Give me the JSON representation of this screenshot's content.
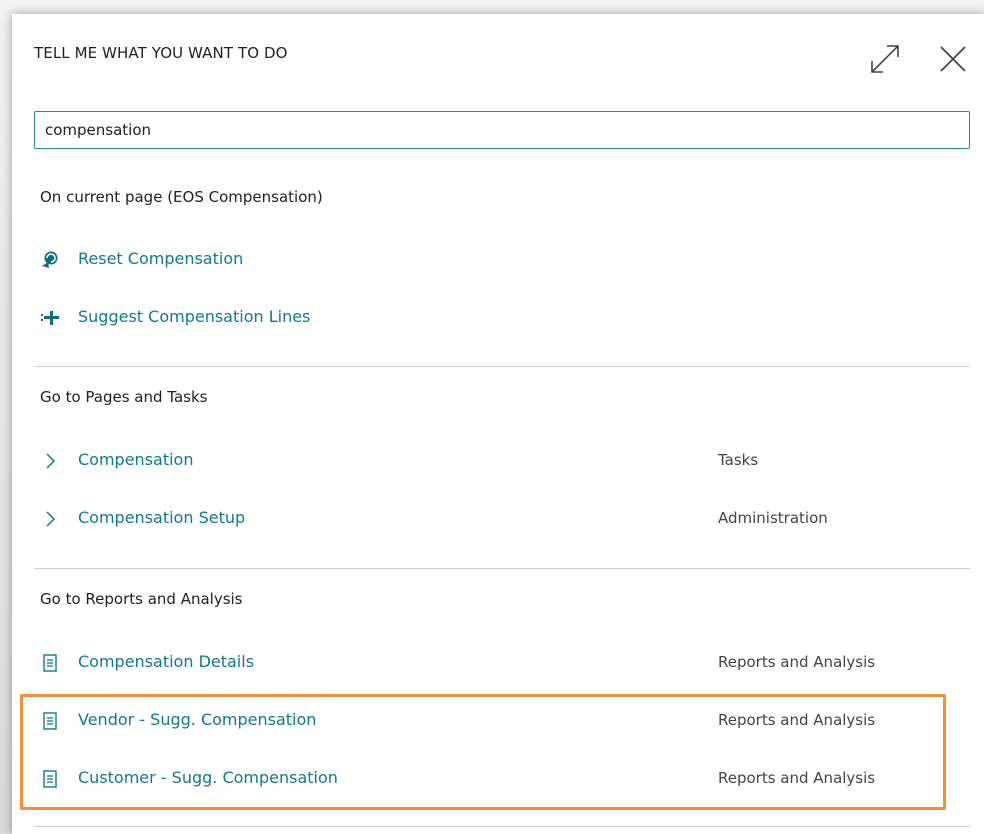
{
  "dialog": {
    "title": "TELL ME WHAT YOU WANT TO DO",
    "expand_icon": "expand-icon",
    "close_icon": "close-icon"
  },
  "search": {
    "value": "compensation",
    "placeholder": ""
  },
  "sections": {
    "current_page": {
      "header": "On current page (EOS Compensation)",
      "items": [
        {
          "label": "Reset Compensation",
          "icon": "reset-icon"
        },
        {
          "label": "Suggest Compensation Lines",
          "icon": "suggest-lines-icon"
        }
      ]
    },
    "pages_tasks": {
      "header": "Go to Pages and Tasks",
      "items": [
        {
          "label": "Compensation",
          "category": "Tasks",
          "icon": "chevron-right-icon"
        },
        {
          "label": "Compensation Setup",
          "category": "Administration",
          "icon": "chevron-right-icon"
        }
      ]
    },
    "reports": {
      "header": "Go to Reports and Analysis",
      "items": [
        {
          "label": "Compensation Details",
          "category": "Reports and Analysis",
          "icon": "report-icon"
        },
        {
          "label": "Vendor - Sugg. Compensation",
          "category": "Reports and Analysis",
          "icon": "report-icon"
        },
        {
          "label": "Customer - Sugg. Compensation",
          "category": "Reports and Analysis",
          "icon": "report-icon"
        }
      ]
    }
  },
  "colors": {
    "link": "#117a8b",
    "accent_border": "#2a8a8a",
    "highlight": "#f0913a"
  }
}
